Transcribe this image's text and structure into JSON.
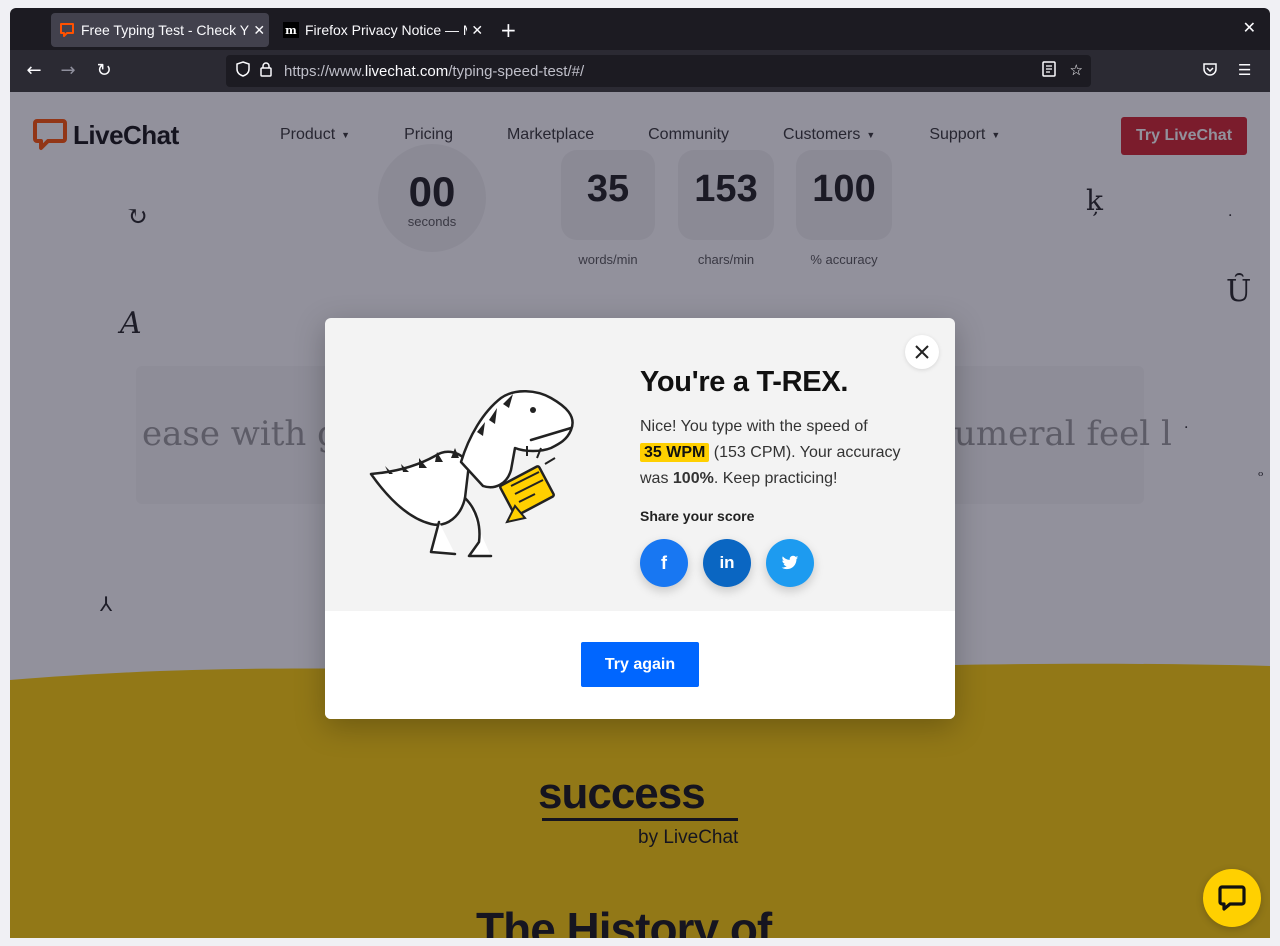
{
  "browser": {
    "tabs": [
      {
        "title": "Free Typing Test - Check Y",
        "active": true
      },
      {
        "title": "Firefox Privacy Notice — M",
        "active": false
      }
    ],
    "new_tab_label": "+",
    "window_close_label": "✕",
    "url": {
      "scheme": "https://www.",
      "host": "livechat.com",
      "path": "/typing-speed-test/#/"
    }
  },
  "site": {
    "logo_text": "LiveChat",
    "brand_color": "#d32029",
    "nav": [
      {
        "label": "Product",
        "has_menu": true
      },
      {
        "label": "Pricing",
        "has_menu": false
      },
      {
        "label": "Marketplace",
        "has_menu": false
      },
      {
        "label": "Community",
        "has_menu": false
      },
      {
        "label": "Customers",
        "has_menu": true
      },
      {
        "label": "Support",
        "has_menu": true
      }
    ],
    "cta_label": "Try LiveChat"
  },
  "stats": {
    "timer_value": "00",
    "timer_unit": "seconds",
    "items": [
      {
        "value": "35",
        "label": "words/min"
      },
      {
        "value": "153",
        "label": "chars/min"
      },
      {
        "value": "100",
        "label": "% accuracy"
      }
    ]
  },
  "typing": {
    "left_text": "ease with go",
    "right_text": "umeral feel l"
  },
  "success_block": {
    "logo_word": "success",
    "by_line": "by LiveChat",
    "heading": "The History of"
  },
  "modal": {
    "title": "You're a T-REX.",
    "body_prefix": "Nice! You type with the speed of",
    "wpm_badge": "35 WPM",
    "body_middle": "(153 CPM). Your accuracy was",
    "accuracy": "100%",
    "body_suffix": ". Keep practicing!",
    "share_label": "Share your score",
    "share_buttons": [
      {
        "name": "facebook",
        "glyph": "f",
        "color": "#1877f2"
      },
      {
        "name": "linkedin",
        "glyph": "in",
        "color": "#0a66c2"
      },
      {
        "name": "twitter",
        "glyph": "🐦",
        "color": "#1d9bf0"
      }
    ],
    "try_again_label": "Try again",
    "button_color": "#0066ff",
    "badge_color": "#ffd000"
  },
  "chat_widget": {
    "icon": "chat-bubble-icon",
    "color": "#ffd000"
  }
}
